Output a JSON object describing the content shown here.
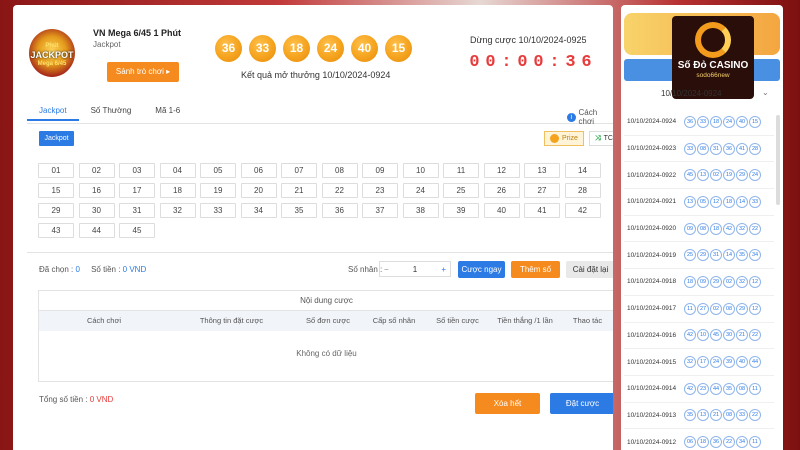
{
  "header": {
    "logo_lines": [
      "Phút",
      "JACKPOT",
      "Mega 6/45"
    ],
    "title": "VN Mega 6/45 1 Phút",
    "subtitle": "Jackpot",
    "lobby_button": "Sảnh trò chơi ▸",
    "balls": [
      "36",
      "33",
      "18",
      "24",
      "40",
      "15"
    ],
    "result_label": "Kết quả mở thưởng 10/10/2024-0924",
    "countdown_label": "Dừng cược 10/10/2024-0925",
    "countdown": [
      "0",
      "0",
      ":",
      "0",
      "0",
      ":",
      "3",
      "6"
    ]
  },
  "tabs": [
    "Jackpot",
    "Số Thường",
    "Mã 1-6"
  ],
  "help_label": "Cách chơi",
  "subtab": "Jackpot",
  "pick_buttons": {
    "prize": "Prize",
    "tc": "TC"
  },
  "numbers": [
    "01",
    "02",
    "03",
    "04",
    "05",
    "06",
    "07",
    "08",
    "09",
    "10",
    "11",
    "12",
    "13",
    "14",
    "15",
    "16",
    "17",
    "18",
    "19",
    "20",
    "21",
    "22",
    "23",
    "24",
    "25",
    "26",
    "27",
    "28",
    "29",
    "30",
    "31",
    "32",
    "33",
    "34",
    "35",
    "36",
    "37",
    "38",
    "39",
    "40",
    "41",
    "42",
    "43",
    "44",
    "45"
  ],
  "stats": {
    "selected_label": "Đã chọn :",
    "selected_value": "0",
    "amount_label": "Số tiền :",
    "amount_value": "0 VND"
  },
  "multiplier": {
    "label": "Số nhân :",
    "minus": "−",
    "value": "1",
    "plus": "+"
  },
  "buttons": {
    "quick": "Cược ngay",
    "add": "Thêm số",
    "reset": "Cài đặt lại",
    "clear": "Xóa hết",
    "bet": "Đặt cược"
  },
  "table": {
    "title": "Nội dung cược",
    "columns": [
      "Cách chơi",
      "Thông tin đặt cược",
      "Số đơn cược",
      "Cấp số nhân",
      "Số tiền cược",
      "Tiền thắng /1 lần",
      "Thao tác"
    ],
    "empty": "Không có dữ liệu"
  },
  "total": {
    "label": "Tổng số tiền :",
    "value": "0 VND"
  },
  "sidebar": {
    "brand_title": "Số Đỏ CASINO",
    "brand_sub": "sodo66new",
    "date": "10/10/2024-0924",
    "rows": [
      {
        "id": "10/10/2024-0924",
        "nums": [
          "36",
          "33",
          "18",
          "24",
          "40",
          "15"
        ]
      },
      {
        "id": "10/10/2024-0923",
        "nums": [
          "33",
          "08",
          "31",
          "36",
          "41",
          "28"
        ]
      },
      {
        "id": "10/10/2024-0922",
        "nums": [
          "45",
          "13",
          "02",
          "19",
          "29",
          "24"
        ]
      },
      {
        "id": "10/10/2024-0921",
        "nums": [
          "13",
          "05",
          "12",
          "18",
          "14",
          "33"
        ]
      },
      {
        "id": "10/10/2024-0920",
        "nums": [
          "09",
          "08",
          "18",
          "42",
          "32",
          "22"
        ]
      },
      {
        "id": "10/10/2024-0919",
        "nums": [
          "25",
          "29",
          "31",
          "14",
          "35",
          "34"
        ]
      },
      {
        "id": "10/10/2024-0918",
        "nums": [
          "18",
          "09",
          "29",
          "02",
          "32",
          "12"
        ]
      },
      {
        "id": "10/10/2024-0917",
        "nums": [
          "11",
          "27",
          "02",
          "08",
          "29",
          "12"
        ]
      },
      {
        "id": "10/10/2024-0916",
        "nums": [
          "42",
          "10",
          "45",
          "30",
          "21",
          "22"
        ]
      },
      {
        "id": "10/10/2024-0915",
        "nums": [
          "32",
          "17",
          "24",
          "39",
          "40",
          "44"
        ]
      },
      {
        "id": "10/10/2024-0914",
        "nums": [
          "42",
          "23",
          "44",
          "35",
          "08",
          "11"
        ]
      },
      {
        "id": "10/10/2024-0913",
        "nums": [
          "35",
          "13",
          "21",
          "08",
          "33",
          "22"
        ]
      },
      {
        "id": "10/10/2024-0912",
        "nums": [
          "06",
          "18",
          "36",
          "22",
          "34",
          "11"
        ]
      }
    ]
  }
}
